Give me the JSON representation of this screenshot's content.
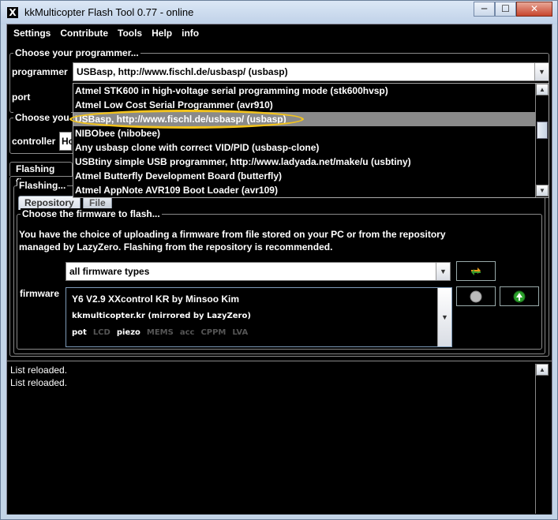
{
  "window": {
    "title": "kkMulticopter Flash Tool 0.77 - online",
    "app_icon_glyph": "X",
    "min_glyph": "─",
    "max_glyph": "☐",
    "close_glyph": "✕"
  },
  "menu": [
    "Settings",
    "Contribute",
    "Tools",
    "Help",
    "info"
  ],
  "programmer_group": {
    "legend": "Choose your programmer...",
    "programmer_label": "programmer",
    "programmer_value": "USBasp, http://www.fischl.de/usbasp/ (usbasp)",
    "port_label": "port"
  },
  "controller_group": {
    "legend_visible": "Choose you",
    "controller_label": "controller",
    "controller_value_visible": "Ho"
  },
  "dropdown": {
    "items": [
      "Atmel STK600 in high-voltage serial programming mode (stk600hvsp)",
      "Atmel Low Cost Serial Programmer (avr910)",
      "USBasp, http://www.fischl.de/usbasp/ (usbasp)",
      "NIBObee (nibobee)",
      "Any usbasp clone with correct VID/PID (usbasp-clone)",
      "USBtiny simple USB programmer, http://www.ladyada.net/make/u (usbtiny)",
      "Atmel Butterfly Development Board (butterfly)",
      "Atmel AppNote AVR109 Boot Loader (avr109)"
    ],
    "selected_index": 2,
    "highlight_color": "#f2c31d"
  },
  "tabs": {
    "main_tab_visible": "Flashing firm",
    "sub_legend": "Flashing...",
    "repository": "Repository",
    "file": "File"
  },
  "firmware_group": {
    "legend": "Choose the firmware to flash...",
    "description_line1": "You have the choice of uploading a firmware from file stored on your PC or from the repository",
    "description_line2": "managed by LazyZero. Flashing from the repository is recommended.",
    "filter_value": "all firmware types",
    "firmware_label": "firmware",
    "selected_firmware": {
      "title": "Y6 V2.9 XXcontrol KR by Minsoo Kim",
      "source": "kkmulticopter.kr (mirrored by LazyZero)",
      "tags": [
        {
          "name": "pot",
          "active": true
        },
        {
          "name": "LCD",
          "active": false
        },
        {
          "name": "piezo",
          "active": true
        },
        {
          "name": "MEMS",
          "active": false
        },
        {
          "name": "acc",
          "active": false
        },
        {
          "name": "CPPM",
          "active": false
        },
        {
          "name": "LVA",
          "active": false
        }
      ]
    }
  },
  "log": {
    "lines": [
      "List reloaded.",
      "List reloaded."
    ]
  }
}
